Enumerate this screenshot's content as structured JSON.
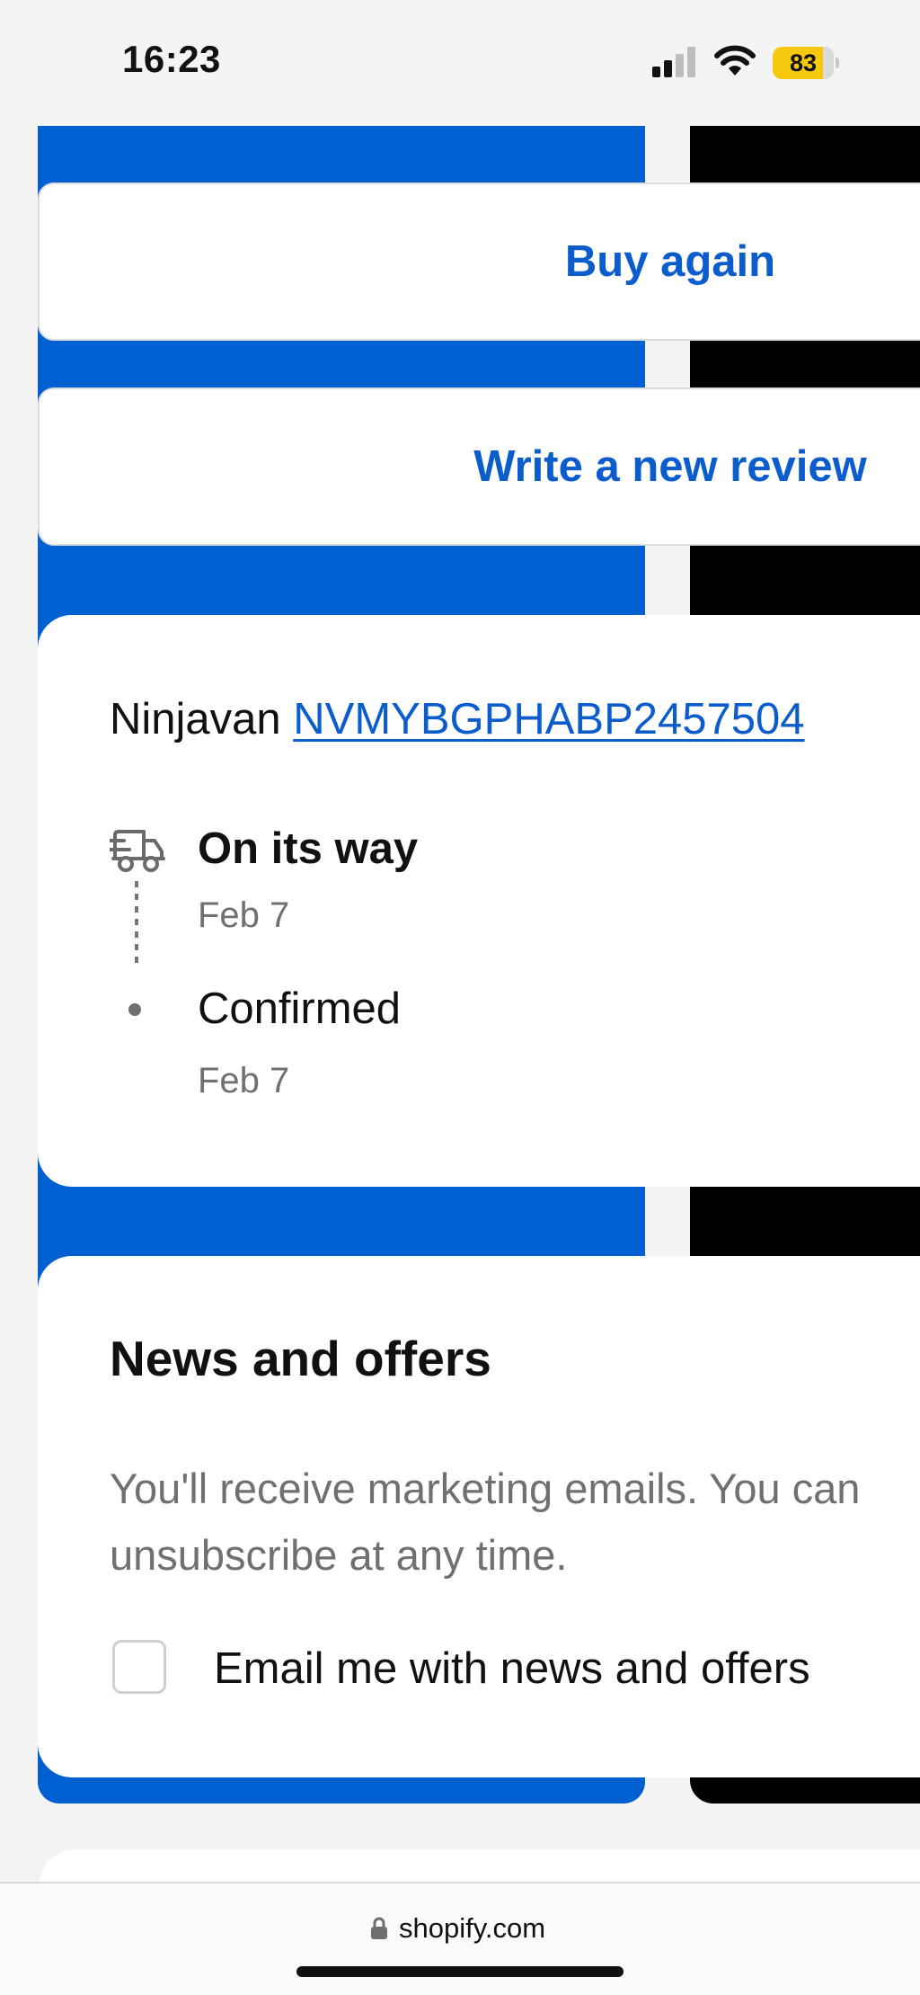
{
  "status_bar": {
    "time": "16:23",
    "battery_level": "83",
    "battery_fraction": 0.83,
    "signal_bars_active": 2,
    "signal_bars_total": 4,
    "icons": [
      "cellular-signal-icon",
      "wifi-icon",
      "battery-icon"
    ],
    "battery_color": "#f6c90e"
  },
  "actions": {
    "buy_again": "Buy again",
    "write_review": "Write a new review"
  },
  "tracking": {
    "carrier": "Ninjavan",
    "tracking_number": "NVMYBGPHABP2457504",
    "events": [
      {
        "title": "On its way",
        "date": "Feb 7",
        "icon": "delivery-truck-icon"
      },
      {
        "title": "Confirmed",
        "date": "Feb 7",
        "icon": "dot-icon"
      }
    ]
  },
  "news": {
    "heading": "News and offers",
    "body": "You'll receive marketing emails. You can unsubscribe at any time.",
    "checkbox_label": "Email me with news and offers",
    "checkbox_checked": false
  },
  "browser": {
    "url": "shopify.com",
    "icon": "lock-icon"
  },
  "colors": {
    "accent": "#0b5ccc",
    "brand_blue": "#0060d2",
    "page_background": "#f4f4f5"
  }
}
